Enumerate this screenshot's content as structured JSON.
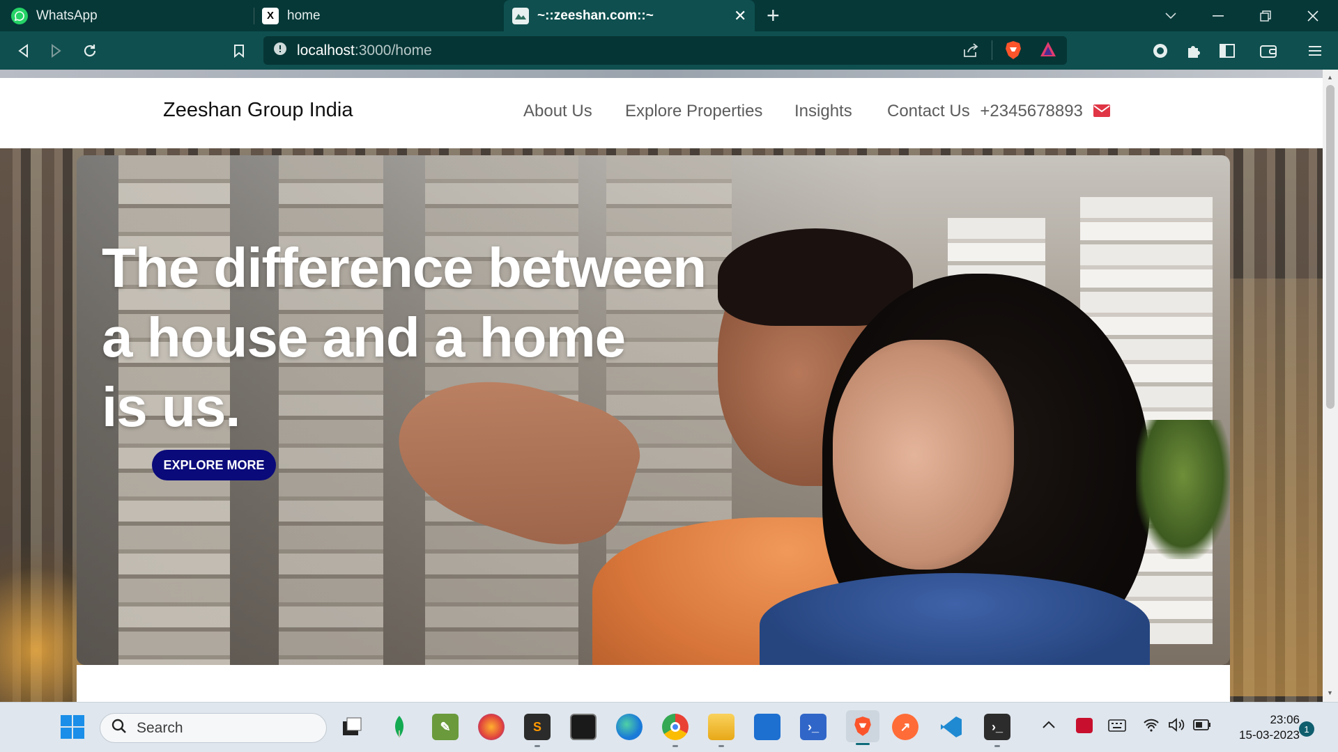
{
  "browser": {
    "tabs": [
      {
        "label": "WhatsApp",
        "icon": "whatsapp-icon"
      },
      {
        "label": "home",
        "icon": "x-logo-icon"
      },
      {
        "label": "~::zeeshan.com::~",
        "icon": "site-favicon-icon",
        "active": true
      }
    ],
    "url": {
      "host": "localhost",
      "path": ":3000/home"
    }
  },
  "site": {
    "brand": "Zeeshan Group India",
    "nav": {
      "about": "About Us",
      "explore": "Explore Properties",
      "insights": "Insights",
      "contact": "Contact Us",
      "phone": "+2345678893"
    },
    "hero": {
      "line1": "The difference between",
      "line2": "a house and a home",
      "line3": "is us.",
      "button": "EXPLORE MORE"
    }
  },
  "taskbar": {
    "search_placeholder": "Search",
    "time": "23:06",
    "date": "15-03-2023",
    "notifications": "1"
  },
  "colors": {
    "tabbar": "#063838",
    "toolbar": "#0f4f4f",
    "hero_button": "#0a0a7a",
    "mail_icon": "#e03545"
  }
}
